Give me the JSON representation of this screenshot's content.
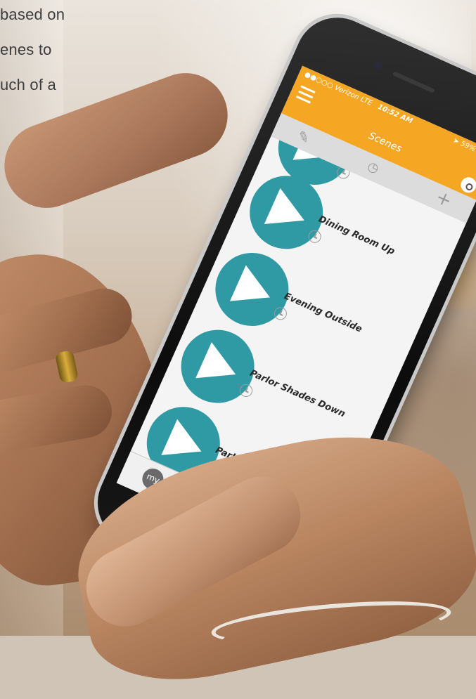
{
  "overlay_text": {
    "line1": "based on",
    "line2": "enes to",
    "line3": "uch of a"
  },
  "status_bar": {
    "carrier": "Verizon",
    "network": "LTE",
    "time": "10:52 AM",
    "battery": "59%"
  },
  "header": {
    "title": "Scenes"
  },
  "toolbar": {
    "edit_icon": "pencil-icon",
    "schedule_icon": "clock-icon",
    "add_icon": "plus-icon"
  },
  "scenes": [
    {
      "name": ""
    },
    {
      "name": "Dining Room Up"
    },
    {
      "name": "Evening Outside"
    },
    {
      "name": "Parlor Shades Down"
    },
    {
      "name": "Parlor Shades Up"
    }
  ],
  "tab_bar": {
    "my_label": "my"
  },
  "colors": {
    "header": "#f5a623",
    "play_button": "#2f9aa3",
    "screen_bg": "#f4f4f4"
  }
}
